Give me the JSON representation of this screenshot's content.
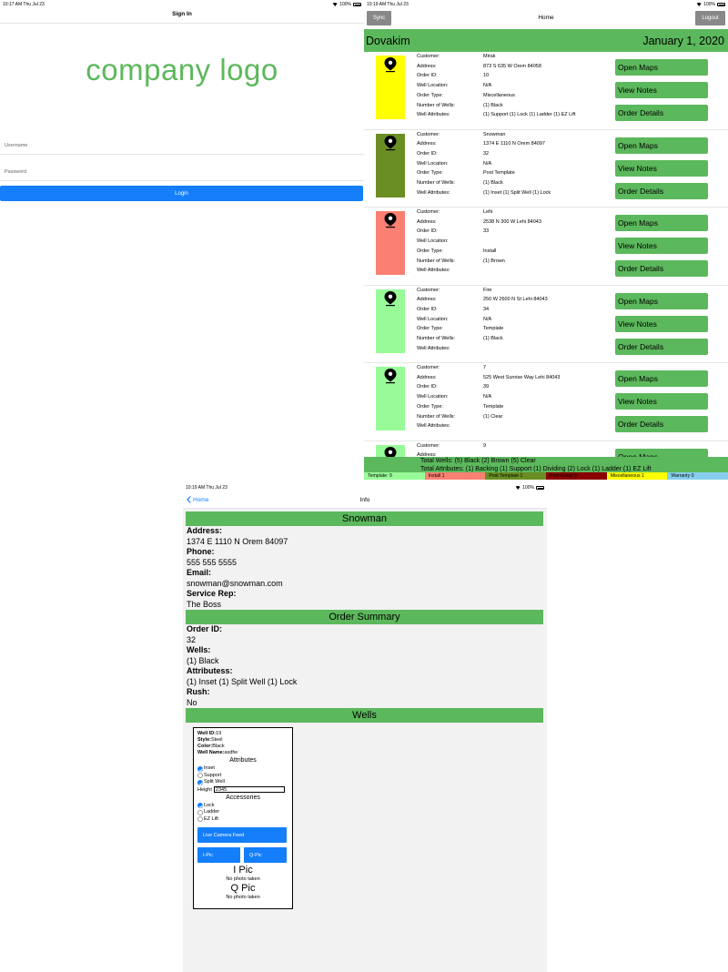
{
  "signin": {
    "status_time": "10:17 AM   Thu Jul 23",
    "status_battery": "100%",
    "title": "Sign In",
    "logo": "company logo",
    "username_placeholder": "Username",
    "password_placeholder": "Password",
    "login_label": "Login"
  },
  "home": {
    "status_time": "10:19 AM   Thu Jul 23",
    "status_battery": "100%",
    "sync_label": "Sync",
    "title": "Home",
    "logout_label": "Logout",
    "user": "Dovakim",
    "date": "January 1, 2020",
    "field_labels": [
      "Customer:",
      "Address:",
      "Order ID:",
      "Well Location:",
      "Order Type:",
      "Number of Wells:",
      "Well Attributes:"
    ],
    "buttons": {
      "maps": "Open Maps",
      "notes": "View Notes",
      "details": "Order Details"
    },
    "orders": [
      {
        "color": "#ffff00",
        "customer": "Mirak",
        "address": "873 S 635 W Orem 84058",
        "order_id": "10",
        "location": "N/A",
        "type": "Miscellaneous",
        "wells": "(1) Black",
        "attributes": "(1) Support (1) Lock (1) Ladder (1) EZ Lift"
      },
      {
        "color": "#6b8e23",
        "customer": "Snowman",
        "address": "1374 E 1110 N Orem 84097",
        "order_id": "32",
        "location": "N/A",
        "type": "Post Template",
        "wells": "(1) Black",
        "attributes": "(1) Inset (1) Split Well (1) Lock"
      },
      {
        "color": "#fa8072",
        "customer": "Lehi",
        "address": "2538 N 300 W Lehi 84043",
        "order_id": "33",
        "location": "",
        "type": "Install",
        "wells": "(1) Brown",
        "attributes": ""
      },
      {
        "color": "#98fb98",
        "customer": "Fire",
        "address": "250 W 2600 N St Lehi 84043",
        "order_id": "34",
        "location": "N/A",
        "type": "Template",
        "wells": "(1) Black",
        "attributes": ""
      },
      {
        "color": "#98fb98",
        "customer": "7",
        "address": "525 West Sunrise Way Lehi 84043",
        "order_id": "39",
        "location": "N/A",
        "type": "Template",
        "wells": "(1) Clear",
        "attributes": ""
      },
      {
        "color": "#98fb98",
        "customer": "9",
        "address": "",
        "order_id": "",
        "location": "",
        "type": "",
        "wells": "",
        "attributes": ""
      }
    ],
    "total_wells": "Total Wells: (5) Black (2) Brown (5) Clear",
    "total_attributes": "Total Attributes: (1) Backing (1) Support (1) Dividing (2) Lock (1) Ladder (1) EZ Lift",
    "legend": [
      {
        "label": "Template: 9",
        "color": "#98fb98"
      },
      {
        "label": "Install 1",
        "color": "#fa8072"
      },
      {
        "label": "Post Template 1",
        "color": "#6b8e23"
      },
      {
        "label": "Post Install 0",
        "color": "#8b0000"
      },
      {
        "label": "Miscellaneous 1",
        "color": "#ffff00"
      },
      {
        "label": "Warranty 0",
        "color": "#87ceeb"
      }
    ]
  },
  "info": {
    "status_time": "10:19 AM   Thu Jul 23",
    "status_battery": "100%",
    "back_label": "Home",
    "title": "Info",
    "customer_name": "Snowman",
    "address_label": "Address:",
    "address": "1374 E 1110 N Orem 84097",
    "phone_label": "Phone:",
    "phone": "555 555 5555",
    "email_label": "Email:",
    "email": "snowman@snowman.com",
    "rep_label": "Service Rep:",
    "rep": "The Boss",
    "summary_header": "Order Summary",
    "order_id_label": "Order ID:",
    "order_id": "32",
    "wells_label": "Wells:",
    "wells": "(1) Black",
    "attributes_label": "Attributess:",
    "attributes": "(1) Inset (1) Split Well (1) Lock",
    "rush_label": "Rush:",
    "rush": "No",
    "wells_header": "Wells",
    "well": {
      "id_label": "Well ID:",
      "id": "19",
      "style_label": "Style:",
      "style": "Steel",
      "color_label": "Color:",
      "color": "Black",
      "name_label": "Well Name:",
      "name": "asdfw",
      "attributes_header": "Attributes",
      "attr_inset": "Inset",
      "attr_support": "Support",
      "attr_split": "Split Well",
      "height_label": "Height",
      "height_value": "2345",
      "accessories_header": "Accessories",
      "acc_lock": "Lock",
      "acc_ladder": "Ladder",
      "acc_ezlift": "EZ Lift",
      "live_feed_label": "Live Camera Feed",
      "ipic_btn": "I-Pic",
      "qpic_btn": "Q-Pic",
      "ipic_title": "I Pic",
      "ipic_none": "No photo taken",
      "qpic_title": "Q Pic",
      "qpic_none": "No photo taken"
    }
  }
}
